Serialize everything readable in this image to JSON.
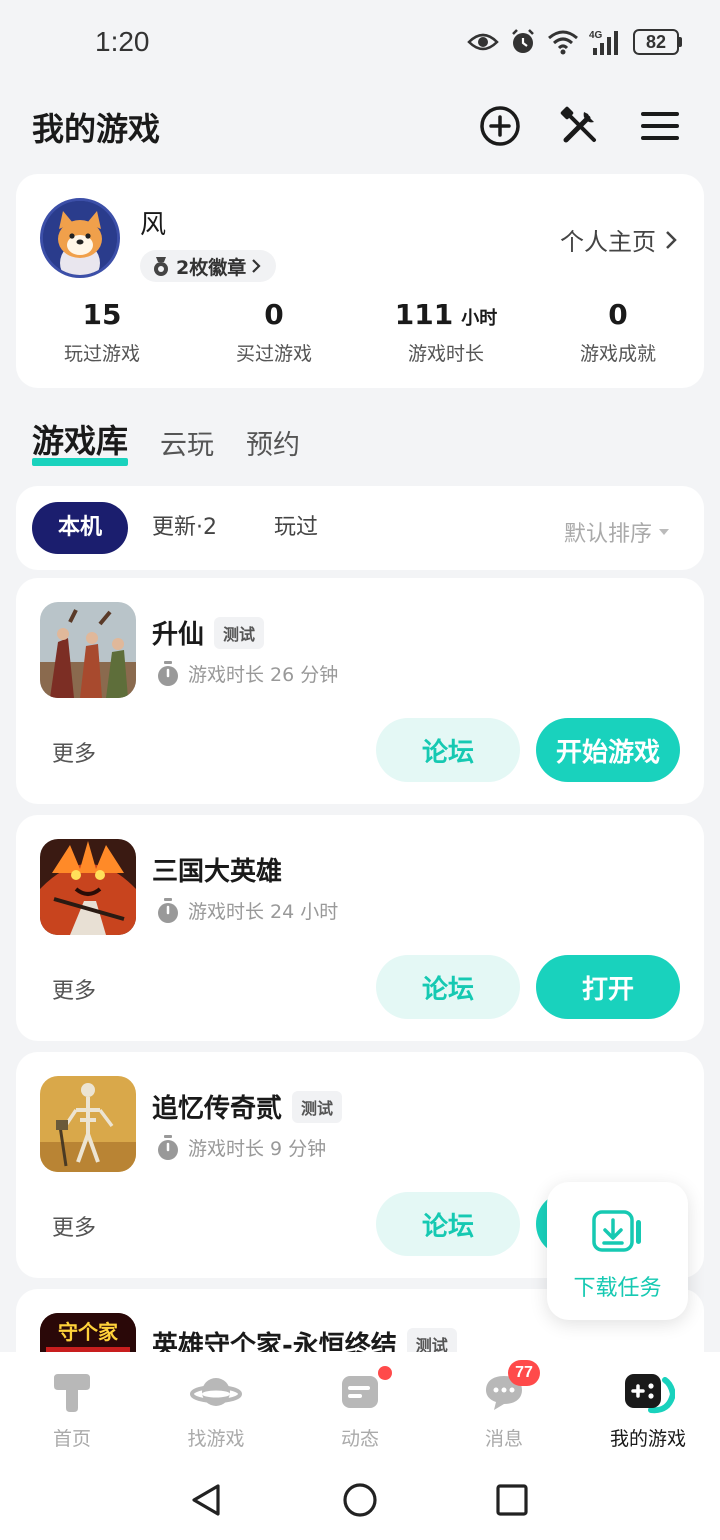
{
  "status_bar": {
    "time": "1:20",
    "battery": "82",
    "network": "4G"
  },
  "header": {
    "title": "我的游戏"
  },
  "profile": {
    "name": "风",
    "badges": "2枚徽章",
    "homepage_link": "个人主页",
    "stats": [
      {
        "value": "15",
        "unit": "",
        "label": "玩过游戏"
      },
      {
        "value": "0",
        "unit": "",
        "label": "买过游戏"
      },
      {
        "value": "111",
        "unit": "小时",
        "label": "游戏时长"
      },
      {
        "value": "0",
        "unit": "",
        "label": "游戏成就"
      }
    ]
  },
  "tabs": [
    "游戏库",
    "云玩",
    "预约"
  ],
  "filters": {
    "local": "本机",
    "updates": "更新·2",
    "played": "玩过",
    "sort": "默认排序"
  },
  "games": [
    {
      "name": "升仙",
      "tag": "测试",
      "playtime": "游戏时长 26 分钟",
      "more": "更多",
      "forum": "论坛",
      "action": "开始游戏"
    },
    {
      "name": "三国大英雄",
      "tag": "",
      "playtime": "游戏时长 24 小时",
      "more": "更多",
      "forum": "论坛",
      "action": "打开"
    },
    {
      "name": "追忆传奇贰",
      "tag": "测试",
      "playtime": "游戏时长 9 分钟",
      "more": "更多",
      "forum": "论坛",
      "action": ""
    },
    {
      "name": "英雄守个家-永恒终结",
      "tag": "测试",
      "icon_text": "守个家"
    }
  ],
  "download": {
    "label": "下载任务"
  },
  "bottom_nav": [
    {
      "label": "首页"
    },
    {
      "label": "找游戏"
    },
    {
      "label": "动态"
    },
    {
      "label": "消息",
      "count": "77"
    },
    {
      "label": "我的游戏"
    }
  ],
  "colors": {
    "accent": "#19d2bd",
    "accent_light": "#e4f8f5",
    "chip_active": "#1b1e6e",
    "badge_red": "#ff4a4a"
  }
}
